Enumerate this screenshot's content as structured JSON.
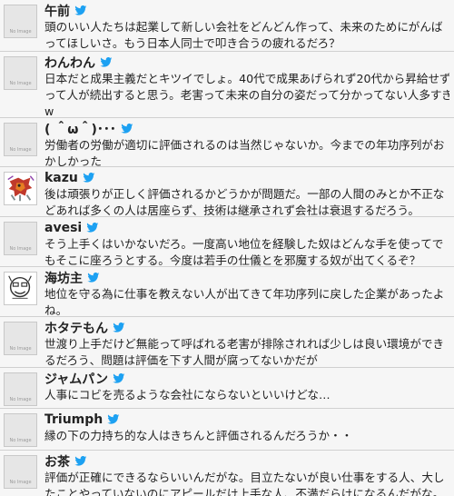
{
  "colors": {
    "accent": "#1da1f2",
    "row_background": "#f6f6f6",
    "divider": "#d0d0d0"
  },
  "avatar_placeholder_text": "No Image",
  "tweets": [
    {
      "user": "午前",
      "avatar": "no-image",
      "lines": [
        "頭のいい人たちは起業して新しい会社をどんどん作って、未来のためにがんば",
        "ってほしいさ。もう日本人同士で叩き合うの疲れるだろ？"
      ]
    },
    {
      "user": "わんわん",
      "avatar": "no-image",
      "lines": [
        "日本だと成果主義だとキツイでしょ。40代で成果あげられず20代から昇給せず",
        "って人が続出すると思う。老害って未来の自分の姿だって分かってない人多すぎ",
        "w"
      ]
    },
    {
      "user": "( ＾ω＾)･･･",
      "avatar": "no-image",
      "lines": [
        "労働者の労働が適切に評価されるのは当然じゃないか。今までの年功序列がお",
        "かしかった"
      ]
    },
    {
      "user": "kazu",
      "avatar": "creature",
      "lines": [
        "後は頑張りが正しく評価されるかどうかが問題だ。一部の人間のみとか不正な",
        "どあれば多くの人は居座らず、技術は継承されず会社は衰退するだろう。"
      ]
    },
    {
      "user": "avesi",
      "avatar": "no-image",
      "lines": [
        "そう上手くはいかないだろ。一度高い地位を経験した奴はどんな手を使ってで",
        "もそこに座ろうとする。今度は若手の仕儀とを邪魔する奴が出てくるぞ？"
      ]
    },
    {
      "user": "海坊主",
      "avatar": "drawing",
      "lines": [
        "地位を守る為に仕事を教えない人が出てきて年功序列に戻した企業があったよ",
        "ね。"
      ]
    },
    {
      "user": "ホタテもん",
      "avatar": "no-image",
      "lines": [
        "世渡り上手だけど無能って呼ばれる老害が排除されれば少しは良い環境ができ",
        "るだろう、問題は評価を下す人間が腐ってないかだが"
      ]
    },
    {
      "user": "ジャムパン",
      "avatar": "no-image",
      "lines": [
        "人事にコビを売るような会社にならないといいけどな…"
      ]
    },
    {
      "user": "Triumph",
      "avatar": "no-image",
      "lines": [
        "縁の下の力持ち的な人はきちんと評価されるんだろうか・・"
      ]
    },
    {
      "user": "お茶",
      "avatar": "no-image",
      "lines": [
        "評価が正確にできるならいいんだがな。目立たないが良い仕事をする人、大し",
        "たことやっていないのにアピールだけ上手な人、不満だらけになるんだがな。"
      ]
    }
  ]
}
